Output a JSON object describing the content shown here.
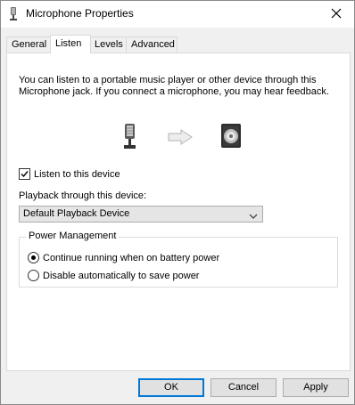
{
  "window": {
    "title": "Microphone Properties",
    "title_icon": "microphone-icon",
    "close_icon": "close-icon"
  },
  "tabs": [
    {
      "label": "General",
      "active": false
    },
    {
      "label": "Listen",
      "active": true
    },
    {
      "label": "Levels",
      "active": false
    },
    {
      "label": "Advanced",
      "active": false
    }
  ],
  "listen": {
    "description": "You can listen to a portable music player or other device through this Microphone jack.  If you connect a microphone, you may hear feedback.",
    "illustration": [
      "microphone-icon",
      "arrow-right-icon",
      "speaker-icon"
    ],
    "listen_checkbox": {
      "label": "Listen to this device",
      "checked": true
    },
    "playback_label": "Playback through this device:",
    "playback_device": "Default Playback Device",
    "power": {
      "title": "Power Management",
      "options": [
        {
          "label": "Continue running when on battery power",
          "selected": true
        },
        {
          "label": "Disable automatically to save power",
          "selected": false
        }
      ]
    }
  },
  "buttons": {
    "ok": "OK",
    "cancel": "Cancel",
    "apply": "Apply"
  },
  "colors": {
    "accent": "#0078d7",
    "dialog_bg": "#f0f0f0",
    "panel_bg": "#ffffff"
  }
}
